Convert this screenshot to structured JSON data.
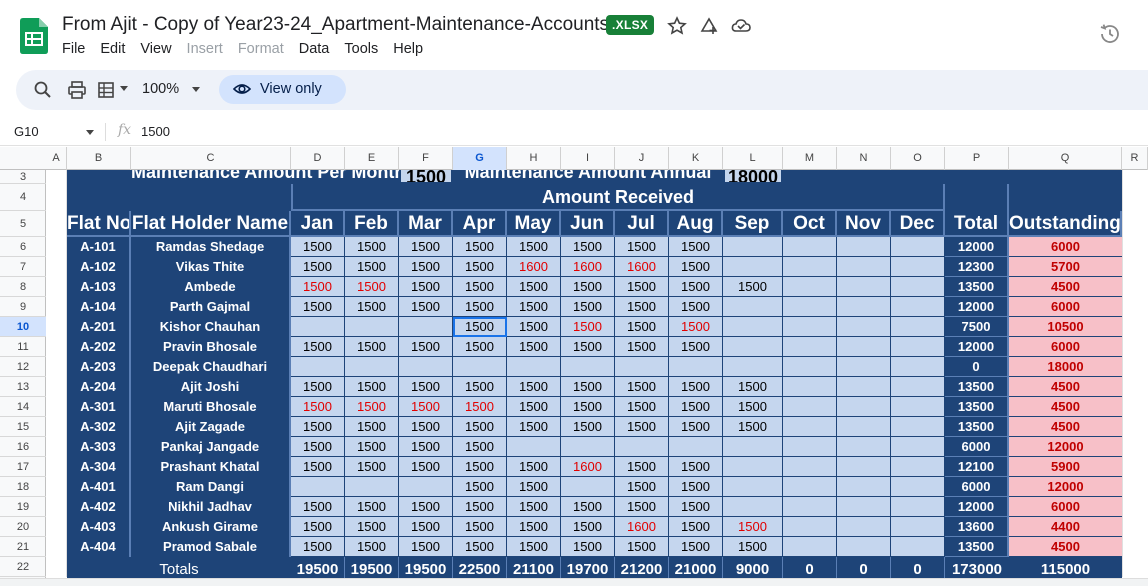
{
  "doc": {
    "title": "From Ajit - Copy of Year23-24_Apartment-Maintenance-Accounts",
    "badge": ".XLSX"
  },
  "menu": [
    "File",
    "Edit",
    "View",
    "Insert",
    "Format",
    "Data",
    "Tools",
    "Help"
  ],
  "menu_disabled": [
    "Insert",
    "Format"
  ],
  "toolbar": {
    "zoom": "100%",
    "view_only": "View only"
  },
  "formula_bar": {
    "cell_ref": "G10",
    "fx": "fx",
    "value": "1500"
  },
  "grid": {
    "columns": [
      "A",
      "B",
      "C",
      "D",
      "E",
      "F",
      "G",
      "H",
      "I",
      "J",
      "K",
      "L",
      "M",
      "N",
      "O",
      "P",
      "Q",
      "R"
    ],
    "selected_column": "G",
    "row_numbers": [
      "3",
      "4",
      "5",
      "6",
      "7",
      "8",
      "9",
      "10",
      "11",
      "12",
      "13",
      "14",
      "15",
      "16",
      "17",
      "18",
      "19",
      "20",
      "21",
      "22"
    ],
    "selected_row": "10"
  },
  "sheet": {
    "row3": {
      "label_monthly": "Maintenance Amount Per Month",
      "monthly_value": "1500",
      "label_annual": "Maintenance Amount Annual",
      "annual_value": "18000"
    },
    "amount_received": "Amount Received",
    "headers": [
      "Flat No",
      "Flat Holder Name",
      "Jan",
      "Feb",
      "Mar",
      "Apr",
      "May",
      "Jun",
      "Jul",
      "Aug",
      "Sep",
      "Oct",
      "Nov",
      "Dec",
      "Total",
      "Outstanding"
    ],
    "rows": [
      {
        "flat": "A-101",
        "name": "Ramdas Shedage",
        "m": [
          "1500",
          "1500",
          "1500",
          "1500",
          "1500",
          "1500",
          "1500",
          "1500",
          "",
          "",
          "",
          ""
        ],
        "total": "12000",
        "out": "6000"
      },
      {
        "flat": "A-102",
        "name": "Vikas Thite",
        "m": [
          "1500",
          "1500",
          "1500",
          "1500",
          "1600",
          "1600",
          "1600",
          "1500",
          "",
          "",
          "",
          ""
        ],
        "total": "12300",
        "out": "5700"
      },
      {
        "flat": "A-103",
        "name": "Ambede",
        "m": [
          "1500",
          "1500",
          "1500",
          "1500",
          "1500",
          "1500",
          "1500",
          "1500",
          "1500",
          "",
          "",
          ""
        ],
        "total": "13500",
        "out": "4500"
      },
      {
        "flat": "A-104",
        "name": "Parth Gajmal",
        "m": [
          "1500",
          "1500",
          "1500",
          "1500",
          "1500",
          "1500",
          "1500",
          "1500",
          "",
          "",
          "",
          ""
        ],
        "total": "12000",
        "out": "6000"
      },
      {
        "flat": "A-201",
        "name": "Kishor Chauhan",
        "m": [
          "",
          "",
          "",
          "1500",
          "1500",
          "1500",
          "1500",
          "1500",
          "",
          "",
          "",
          ""
        ],
        "total": "7500",
        "out": "10500"
      },
      {
        "flat": "A-202",
        "name": "Pravin Bhosale",
        "m": [
          "1500",
          "1500",
          "1500",
          "1500",
          "1500",
          "1500",
          "1500",
          "1500",
          "",
          "",
          "",
          ""
        ],
        "total": "12000",
        "out": "6000"
      },
      {
        "flat": "A-203",
        "name": "Deepak Chaudhari",
        "m": [
          "",
          "",
          "",
          "",
          "",
          "",
          "",
          "",
          "",
          "",
          "",
          ""
        ],
        "total": "0",
        "out": "18000"
      },
      {
        "flat": "A-204",
        "name": "Ajit Joshi",
        "m": [
          "1500",
          "1500",
          "1500",
          "1500",
          "1500",
          "1500",
          "1500",
          "1500",
          "1500",
          "",
          "",
          ""
        ],
        "total": "13500",
        "out": "4500"
      },
      {
        "flat": "A-301",
        "name": "Maruti Bhosale",
        "m": [
          "1500",
          "1500",
          "1500",
          "1500",
          "1500",
          "1500",
          "1500",
          "1500",
          "1500",
          "",
          "",
          ""
        ],
        "total": "13500",
        "out": "4500"
      },
      {
        "flat": "A-302",
        "name": "Ajit Zagade",
        "m": [
          "1500",
          "1500",
          "1500",
          "1500",
          "1500",
          "1500",
          "1500",
          "1500",
          "1500",
          "",
          "",
          ""
        ],
        "total": "13500",
        "out": "4500"
      },
      {
        "flat": "A-303",
        "name": "Pankaj Jangade",
        "m": [
          "1500",
          "1500",
          "1500",
          "1500",
          "",
          "",
          "",
          "",
          "",
          "",
          "",
          ""
        ],
        "total": "6000",
        "out": "12000"
      },
      {
        "flat": "A-304",
        "name": "Prashant Khatal",
        "m": [
          "1500",
          "1500",
          "1500",
          "1500",
          "1500",
          "1600",
          "1500",
          "1500",
          "",
          "",
          "",
          ""
        ],
        "total": "12100",
        "out": "5900"
      },
      {
        "flat": "A-401",
        "name": "Ram Dangi",
        "m": [
          "",
          "",
          "",
          "1500",
          "1500",
          "",
          "1500",
          "1500",
          "",
          "",
          "",
          ""
        ],
        "total": "6000",
        "out": "12000"
      },
      {
        "flat": "A-402",
        "name": "Nikhil Jadhav",
        "m": [
          "1500",
          "1500",
          "1500",
          "1500",
          "1500",
          "1500",
          "1500",
          "1500",
          "",
          "",
          "",
          ""
        ],
        "total": "12000",
        "out": "6000"
      },
      {
        "flat": "A-403",
        "name": "Ankush Girame",
        "m": [
          "1500",
          "1500",
          "1500",
          "1500",
          "1500",
          "1500",
          "1600",
          "1500",
          "1500",
          "",
          "",
          ""
        ],
        "total": "13600",
        "out": "4400"
      },
      {
        "flat": "A-404",
        "name": "Pramod Sabale",
        "m": [
          "1500",
          "1500",
          "1500",
          "1500",
          "1500",
          "1500",
          "1500",
          "1500",
          "1500",
          "",
          "",
          ""
        ],
        "total": "13500",
        "out": "4500"
      }
    ],
    "totals": {
      "label": "Totals",
      "m": [
        "19500",
        "19500",
        "19500",
        "22500",
        "21100",
        "19700",
        "21200",
        "21000",
        "9000",
        "0",
        "0",
        "0"
      ],
      "total": "173000",
      "out": "115000"
    }
  }
}
